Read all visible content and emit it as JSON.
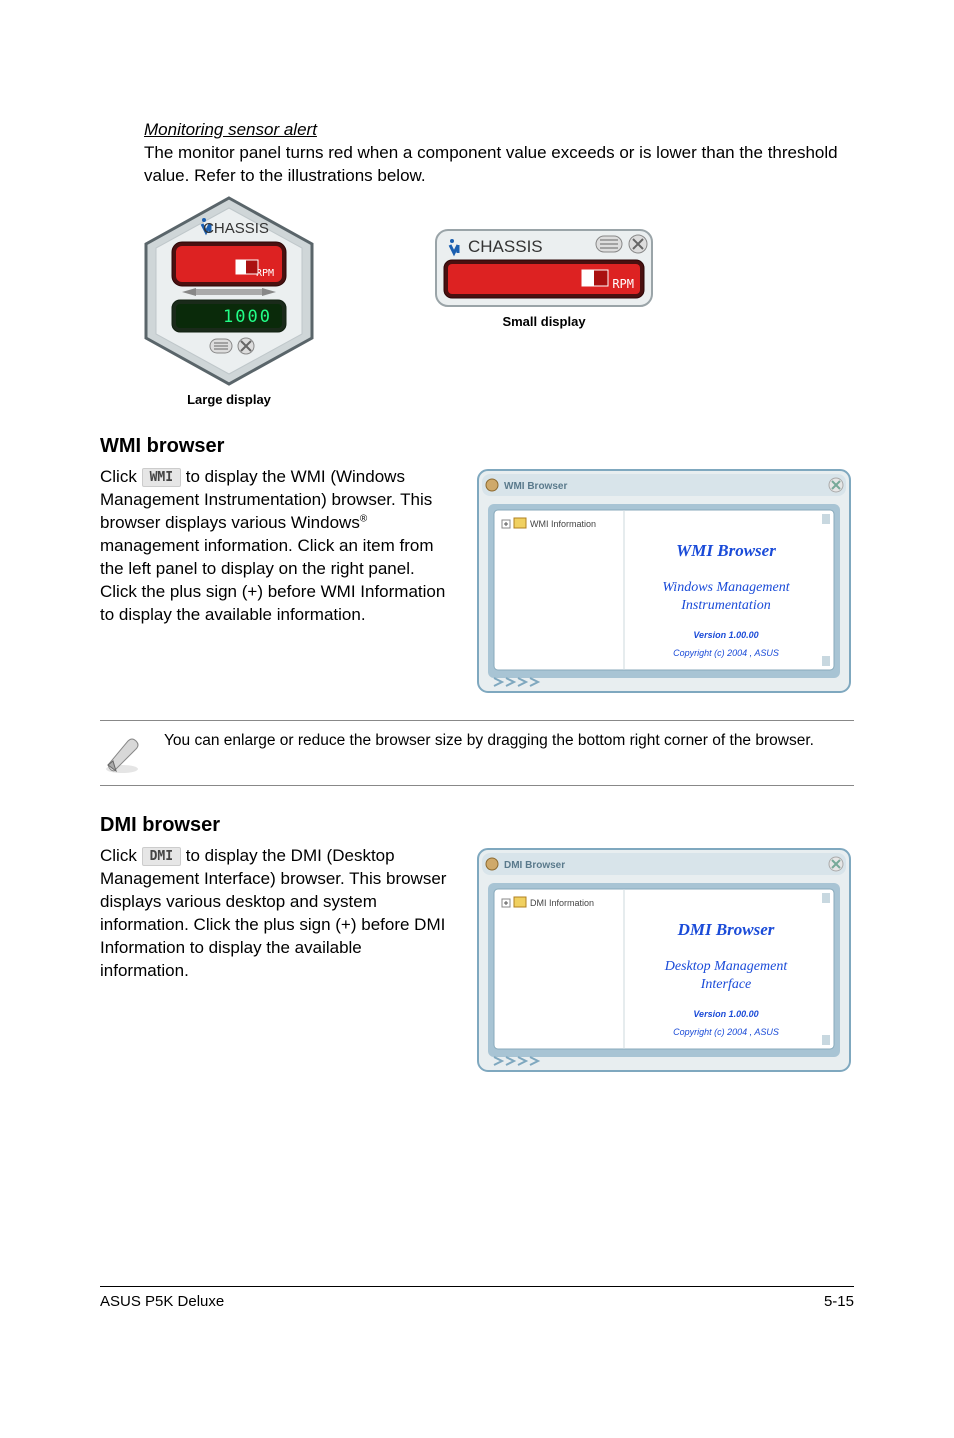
{
  "alert": {
    "heading": "Monitoring sensor alert",
    "body": "The monitor panel turns red when a component value exceeds or is lower than the threshold value. Refer to the illustrations below."
  },
  "gauge": {
    "label": "CHASSIS",
    "rpm_label": "RPM",
    "temp_value": "1000",
    "large_caption": "Large display",
    "small_caption": "Small display"
  },
  "wmi": {
    "title": "WMI browser",
    "pre_button": "Click ",
    "button_label": "WMI",
    "post_button": " to display the WMI (Windows Management Instrumentation) browser. This browser displays various Windows",
    "super": "®",
    "rest": " management information. Click an item from the left panel to display on the right panel. Click the plus sign (+) before WMI Information to display the available information.",
    "shot": {
      "window_title": "WMI Browser",
      "tree_root": "WMI Information",
      "right_title": "WMI Browser",
      "right_sub1": "Windows Management",
      "right_sub2": "Instrumentation",
      "version": "Version 1.00.00",
      "copyright": "Copyright (c) 2004 , ASUS"
    }
  },
  "note": {
    "text": "You can enlarge or reduce the browser size by dragging the bottom right corner of the browser."
  },
  "dmi": {
    "title": "DMI browser",
    "pre_button": "Click ",
    "button_label": "DMI",
    "post_button": " to display the DMI (Desktop Management Interface) browser. This browser displays various desktop and system information. Click the plus sign (+) before DMI Information to display the available information.",
    "shot": {
      "window_title": "DMI Browser",
      "tree_root": "DMI Information",
      "right_title": "DMI Browser",
      "right_sub1": "Desktop Management",
      "right_sub2": "Interface",
      "version": "Version 1.00.00",
      "copyright": "Copyright (c) 2004 , ASUS"
    }
  },
  "footer": {
    "left": "ASUS P5K Deluxe",
    "right": "5-15"
  }
}
